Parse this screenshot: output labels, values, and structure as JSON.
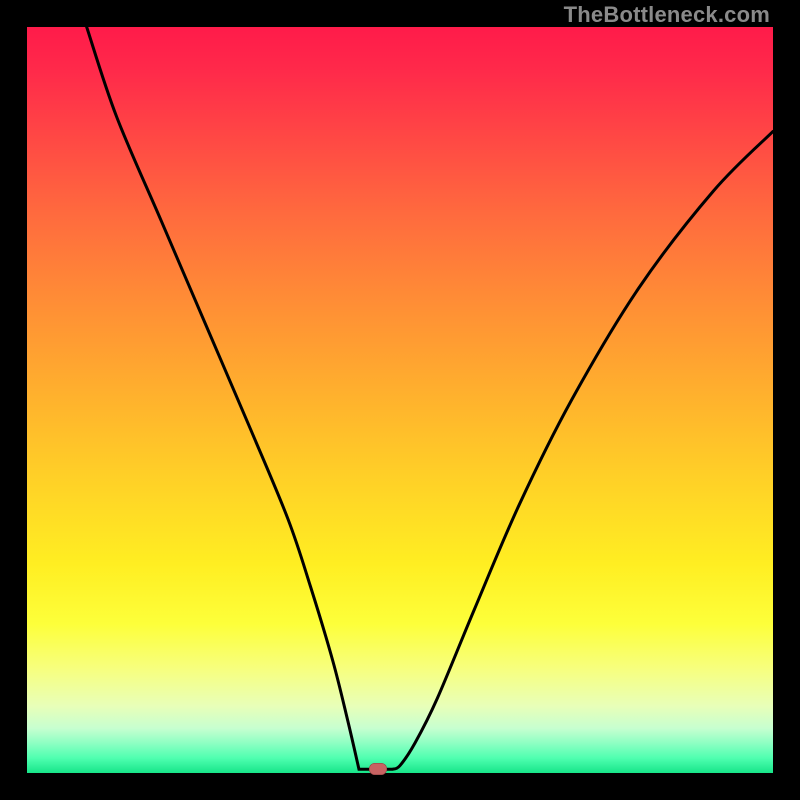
{
  "watermark": "TheBottleneck.com",
  "colors": {
    "frame": "#000000",
    "curve": "#000000",
    "marker": "#c86262",
    "gradient_stops": [
      {
        "pos": 0,
        "hex": "#ff1b4a"
      },
      {
        "pos": 6,
        "hex": "#ff2a4a"
      },
      {
        "pos": 14,
        "hex": "#ff4545"
      },
      {
        "pos": 25,
        "hex": "#ff6a3e"
      },
      {
        "pos": 36,
        "hex": "#ff8b36"
      },
      {
        "pos": 48,
        "hex": "#ffad2e"
      },
      {
        "pos": 60,
        "hex": "#ffcf27"
      },
      {
        "pos": 72,
        "hex": "#ffee22"
      },
      {
        "pos": 80,
        "hex": "#fdff3a"
      },
      {
        "pos": 86,
        "hex": "#f7ff7e"
      },
      {
        "pos": 91,
        "hex": "#e8ffb8"
      },
      {
        "pos": 94,
        "hex": "#c7ffd0"
      },
      {
        "pos": 96,
        "hex": "#8dffc3"
      },
      {
        "pos": 98,
        "hex": "#4fffb0"
      },
      {
        "pos": 100,
        "hex": "#17e589"
      }
    ]
  },
  "chart_data": {
    "type": "line",
    "title": "",
    "xlabel": "",
    "ylabel": "",
    "xlim": [
      0,
      100
    ],
    "ylim": [
      0,
      100
    ],
    "series": [
      {
        "name": "bottleneck-curve",
        "x": [
          8,
          12,
          18,
          24,
          30,
          35,
          38,
          41,
          43,
          44.5,
          46,
          48,
          50,
          52,
          55,
          60,
          66,
          73,
          82,
          92,
          100
        ],
        "y": [
          100,
          88,
          74,
          60,
          46,
          34,
          25,
          15,
          7,
          2,
          0.5,
          0.5,
          1,
          4,
          10,
          22,
          36,
          50,
          65,
          78,
          86
        ]
      }
    ],
    "marker": {
      "x": 47,
      "y": 0.5
    },
    "flat_bottom": {
      "x_start": 44.5,
      "x_end": 49,
      "y": 0.5
    }
  }
}
